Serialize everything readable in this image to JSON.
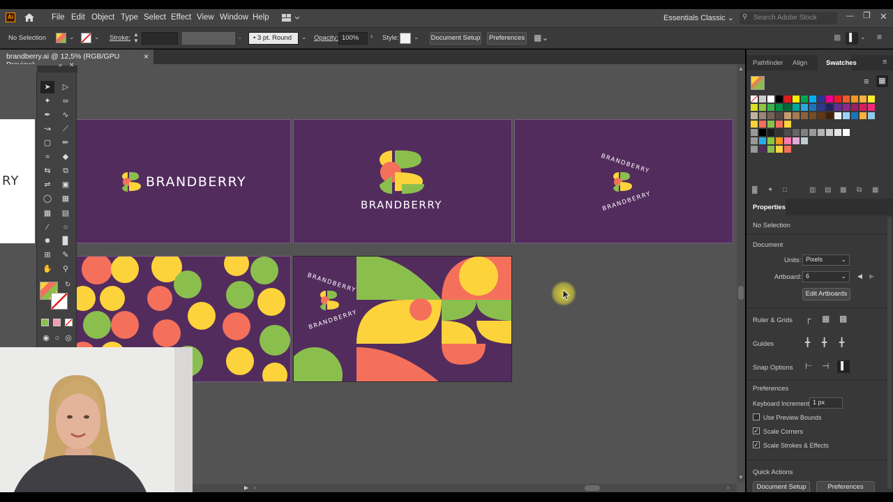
{
  "app": {
    "logo": "Ai"
  },
  "menu": [
    "File",
    "Edit",
    "Object",
    "Type",
    "Select",
    "Effect",
    "View",
    "Window",
    "Help"
  ],
  "workspace": {
    "name": "Essentials Classic",
    "search_placeholder": "Search Adobe Stock"
  },
  "control_bar": {
    "selection": "No Selection",
    "stroke_label": "Stroke:",
    "brush": "3 pt. Round",
    "opacity_label": "Opacity:",
    "opacity_value": "100%",
    "style_label": "Style:",
    "document_setup": "Document Setup",
    "preferences": "Preferences"
  },
  "document_tab": {
    "title": "brandberry.ai @ 12,5% (RGB/GPU Preview)",
    "close": "×"
  },
  "canvas": {
    "brand_name": "BRANDBERRY",
    "partial_text": "RY",
    "badge_top": "BRANDBERRY",
    "badge_bottom": "BRANDBERRY"
  },
  "panels": {
    "tabs": [
      "Pathfinder",
      "Align",
      "Swatches"
    ],
    "active_tab": "Swatches",
    "properties": {
      "title": "Properties",
      "selection": "No Selection",
      "document_label": "Document",
      "units_label": "Units:",
      "units_value": "Pixels",
      "artboard_label": "Artboard:",
      "artboard_value": "6",
      "edit_artboards": "Edit Artboards",
      "ruler_grids": "Ruler & Grids",
      "guides": "Guides",
      "snap_options": "Snap Options",
      "preferences_label": "Preferences",
      "keyboard_increment_label": "Keyboard Increment:",
      "keyboard_increment_value": "1 px",
      "use_preview_bounds": "Use Preview Bounds",
      "use_preview_bounds_checked": false,
      "scale_corners": "Scale Corners",
      "scale_corners_checked": true,
      "scale_strokes": "Scale Strokes & Effects",
      "scale_strokes_checked": true,
      "quick_actions": "Quick Actions",
      "document_setup": "Document Setup",
      "preferences": "Preferences"
    }
  },
  "colors": {
    "purple": "#532c5e",
    "green": "#8bbf4d",
    "yellow": "#fdd33c",
    "coral": "#f4705a",
    "ui_dark": "#383838"
  }
}
